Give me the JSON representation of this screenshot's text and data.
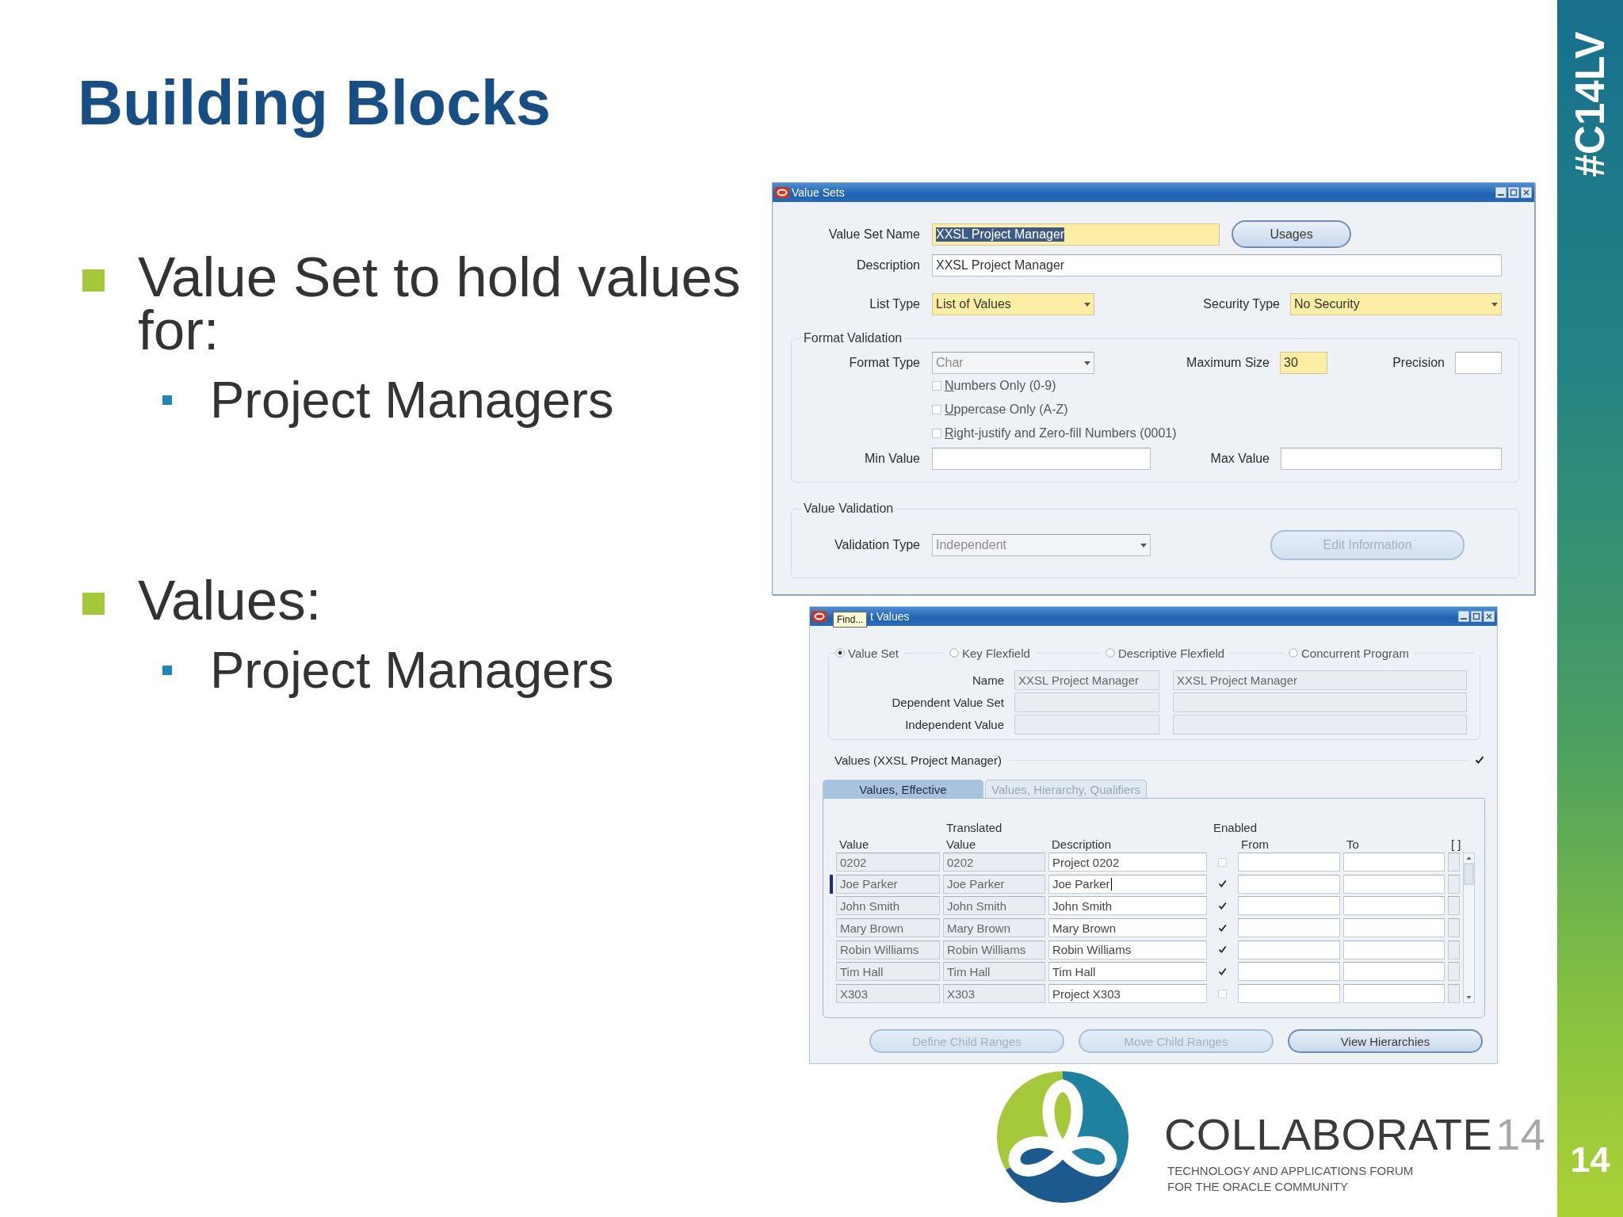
{
  "slide": {
    "title": "Building Blocks",
    "bullets": [
      {
        "text": "Value Set to hold values for:",
        "children": [
          {
            "text": "Project Managers"
          }
        ]
      },
      {
        "text": "Values:",
        "children": [
          {
            "text": "Project Managers"
          }
        ]
      }
    ]
  },
  "value_sets_window": {
    "title": "Value Sets",
    "value_set_name": {
      "label": "Value Set Name",
      "value": "XXSL Project Manager",
      "kind": "text",
      "required": true,
      "disabled": false,
      "text_selected": true
    },
    "usages_button": {
      "label": "Usages",
      "disabled": false
    },
    "description": {
      "label": "Description",
      "value": "XXSL Project Manager",
      "kind": "text",
      "required": false,
      "disabled": false
    },
    "list_type": {
      "label": "List Type",
      "value": "List of Values",
      "kind": "list",
      "required": true,
      "disabled": false
    },
    "security_type": {
      "label": "Security Type",
      "value": "No Security",
      "kind": "list",
      "required": true,
      "disabled": false
    },
    "format_validation": {
      "heading": "Format Validation",
      "format_type": {
        "label": "Format Type",
        "value": "Char",
        "kind": "list",
        "required": false,
        "disabled": true
      },
      "maximum_size": {
        "label": "Maximum Size",
        "value": "30",
        "kind": "text",
        "required": true,
        "disabled": false
      },
      "precision": {
        "label": "Precision",
        "kind": "text",
        "required": false
      },
      "options": [
        {
          "label": "Numbers Only (0-9)",
          "checked": false
        },
        {
          "label": "Uppercase Only (A-Z)",
          "checked": false
        },
        {
          "label": "Right-justify and Zero-fill Numbers (0001)",
          "checked": false
        }
      ],
      "min_value": {
        "label": "Min Value",
        "kind": "text",
        "required": false
      },
      "max_value": {
        "label": "Max Value",
        "kind": "text",
        "required": false
      }
    },
    "value_validation": {
      "heading": "Value Validation",
      "validation_type": {
        "label": "Validation Type",
        "value": "Independent",
        "kind": "list",
        "required": false,
        "disabled": true
      },
      "edit_information_button": {
        "label": "Edit Information",
        "disabled": true
      }
    }
  },
  "values_window": {
    "title": "t Values",
    "tooltip": "Find...",
    "source_options": [
      {
        "label": "Value Set",
        "selected": true
      },
      {
        "label": "Key Flexfield",
        "selected": false
      },
      {
        "label": "Descriptive Flexfield",
        "selected": false
      },
      {
        "label": "Concurrent Program",
        "selected": false
      }
    ],
    "context_rows": [
      {
        "label": "Name",
        "values": [
          "XXSL Project Manager",
          "XXSL Project Manager"
        ],
        "disabled": true
      },
      {
        "label": "Dependent Value Set",
        "disabled": true
      },
      {
        "label": "Independent Value",
        "disabled": true
      }
    ],
    "values_section": {
      "label": "Values (XXSL Project Manager)",
      "checked": true
    },
    "tabs": [
      {
        "label": "Values, Effective",
        "selected": true
      },
      {
        "label": "Values, Hierarchy, Qualifiers",
        "selected": false
      }
    ],
    "table": {
      "columns": [
        "Value",
        "Translated Value",
        "Description",
        "From",
        "To",
        "[ ]"
      ],
      "group_heading": "Enabled",
      "rows": [
        {
          "value": "0202",
          "translated_value": "0202",
          "description": "Project 0202",
          "enabled": false,
          "current": false
        },
        {
          "value": "Joe Parker",
          "translated_value": "Joe Parker",
          "description": "Joe Parker",
          "enabled": true,
          "current": true
        },
        {
          "value": "John Smith",
          "translated_value": "John Smith",
          "description": "John Smith",
          "enabled": true,
          "current": false
        },
        {
          "value": "Mary Brown",
          "translated_value": "Mary Brown",
          "description": "Mary Brown",
          "enabled": true,
          "current": false
        },
        {
          "value": "Robin Williams",
          "translated_value": "Robin Williams",
          "description": "Robin Williams",
          "enabled": true,
          "current": false
        },
        {
          "value": "Tim Hall",
          "translated_value": "Tim Hall",
          "description": "Tim Hall",
          "enabled": true,
          "current": false
        },
        {
          "value": "X303",
          "translated_value": "X303",
          "description": "Project X303",
          "enabled": false,
          "current": false
        }
      ]
    },
    "buttons": [
      {
        "label": "Define Child Ranges",
        "disabled": true
      },
      {
        "label": "Move Child Ranges",
        "disabled": true
      },
      {
        "label": "View Hierarchies",
        "disabled": false
      }
    ]
  },
  "logo": {
    "wordmark": "COLLABORATE",
    "edition": "14",
    "tagline": [
      "TECHNOLOGY AND APPLICATIONS FORUM",
      "FOR THE ORACLE COMMUNITY"
    ]
  },
  "side_bar": {
    "hashtag": "#C14LV",
    "page_number": "14"
  }
}
